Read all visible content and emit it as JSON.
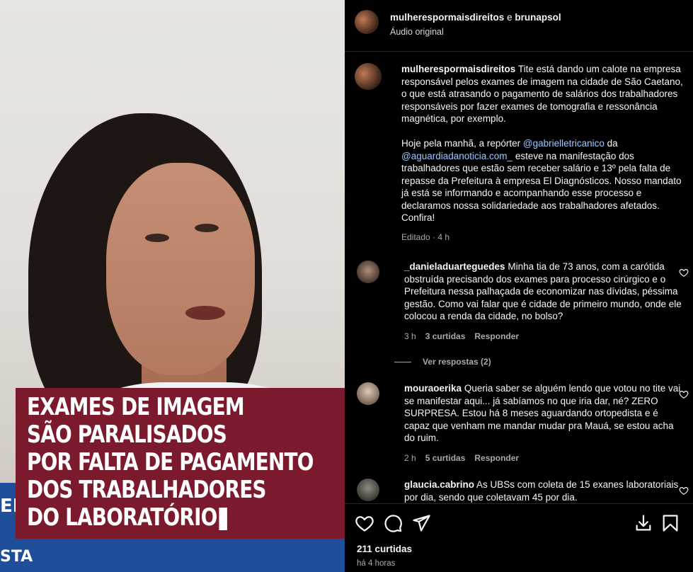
{
  "video": {
    "caption_lines": [
      "EXAMES DE IMAGEM",
      "SÃO PARALISADOS",
      "POR FALTA DE PAGAMENTO",
      "DOS TRABALHADORES",
      "DO LABORATÓRIO"
    ],
    "lower_third_top": "EL",
    "lower_third_bottom": "STA"
  },
  "header": {
    "user1": "mulherespormaisdireitos",
    "conj": "e",
    "user2": "brunapsol",
    "audio": "Áudio original"
  },
  "post": {
    "username": "mulherespormaisdireitos",
    "text1": "Tite está dando um calote na empresa responsável pelos exames de imagem na cidade de São Caetano, o que está atrasando o pagamento de salários dos trabalhadores responsáveis por fazer exames de tomografia e ressonância magnética, por exemplo.",
    "text2_a": "Hoje pela manhã, a repórter",
    "mention1": "@gabrielletricanico",
    "text2_b": "da",
    "mention2": "@aguardiadanoticia.com_",
    "text2_c": "esteve na manifestação dos trabalhadores que estão sem receber salário e 13º pela falta de repasse da Prefeitura à empresa El Diagnósticos. Nosso mandato já está se informando e acompanhando esse processo e declaramos nossa solidariedade aos trabalhadores afetados. Confira!",
    "meta": "Editado · 4 h"
  },
  "comments": [
    {
      "username": "_danieladuarteguedes",
      "text": "Minha tia de 73 anos, com a carótida obstruída precisando dos exames para processo cirúrgico e o Prefeitura nessa palhaçada de economizar nas dívidas, péssima gestão. Como vai falar que é cidade de primeiro mundo, onde ele colocou a renda da cidade, no bolso?",
      "time": "3 h",
      "likes": "3 curtidas",
      "reply": "Responder",
      "view_replies": "Ver respostas (2)"
    },
    {
      "username": "mouraoerika",
      "text": "Queria saber se alguém lendo que votou no tite vai se manifestar aqui... já sabíamos no que iria dar, né? ZERO SURPRESA. Estou há 8 meses aguardando ortopedista e é capaz que venham me mandar mudar pra Mauá, se estou acha do ruim.",
      "time": "2 h",
      "likes": "5 curtidas",
      "reply": "Responder"
    },
    {
      "username": "glaucia.cabrino",
      "text": "As UBSs com coleta de 15 exanes laboratoriais por dia, sendo que coletavam 45 por dia."
    }
  ],
  "footer": {
    "likes": "211 curtidas",
    "time": "há 4 horas"
  },
  "icons": [
    "heart-icon",
    "comment-icon",
    "share-icon",
    "download-icon",
    "bookmark-icon"
  ]
}
